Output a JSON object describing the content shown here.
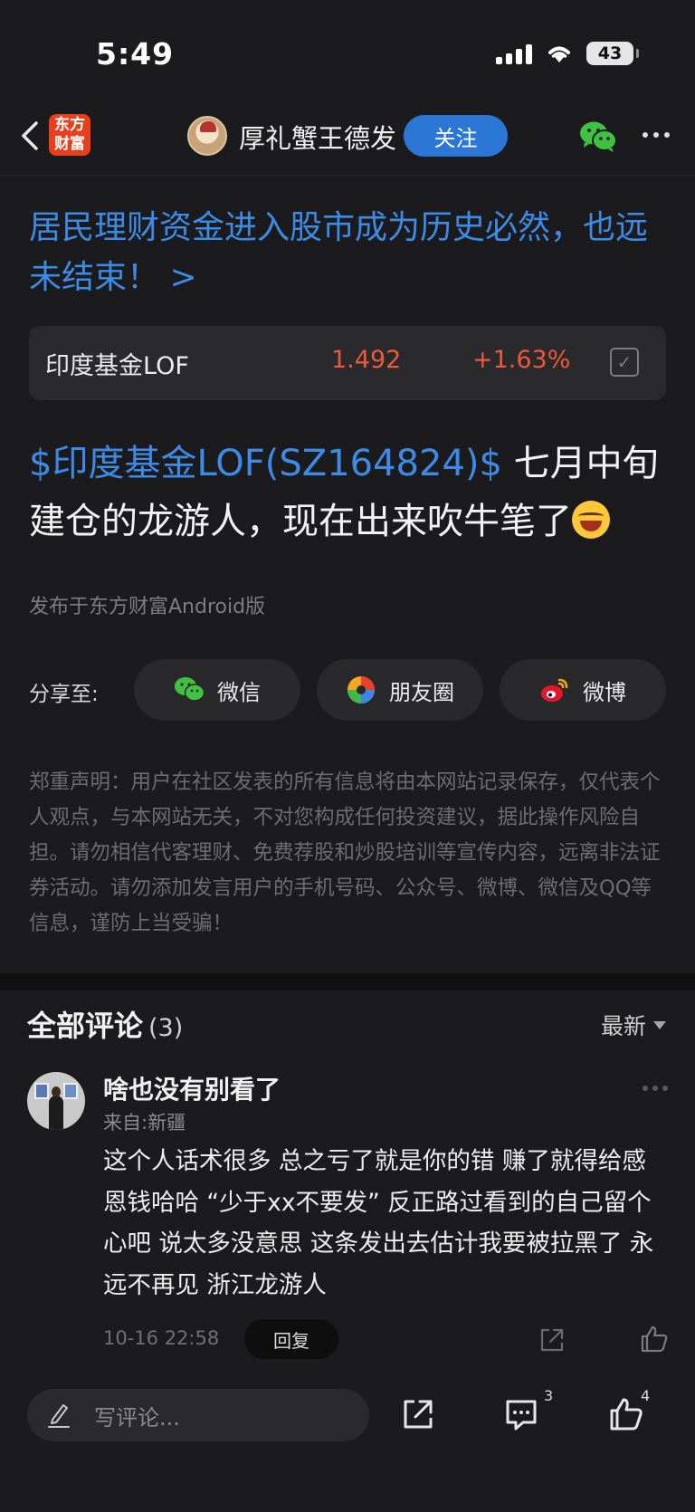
{
  "status_bar": {
    "time": "5:49",
    "battery": "43"
  },
  "nav": {
    "logo_line1": "东方",
    "logo_line2": "财富",
    "user_name": "厚礼蟹王德发",
    "follow_label": "关注"
  },
  "topic_link": "居民理财资金进入股市成为历史必然，也远未结束！ >",
  "fund_card": {
    "name": "印度基金LOF",
    "price": "1.492",
    "change": "+1.63%"
  },
  "post": {
    "stock_tag": "$印度基金LOF(SZ164824)$",
    "body": " 七月中旬建仓的龙游人，现在出来吹牛笔了",
    "source": "发布于东方财富Android版"
  },
  "share": {
    "label": "分享至:",
    "wechat": "微信",
    "moments": "朋友圈",
    "weibo": "微博"
  },
  "disclaimer": "郑重声明：用户在社区发表的所有信息将由本网站记录保存，仅代表个人观点，与本网站无关，不对您构成任何投资建议，据此操作风险自担。请勿相信代客理财、免费荐股和炒股培训等宣传内容，远离非法证券活动。请勿添加发言用户的手机号码、公众号、微博、微信及QQ等信息，谨防上当受骗！",
  "comments": {
    "title": "全部评论",
    "count": "(3)",
    "sort_label": "最新",
    "items": [
      {
        "author": "啥也没有别看了",
        "location": "来自:新疆",
        "text": "这个人话术很多 总之亏了就是你的错 赚了就得给感恩钱哈哈 “少于xx不要发” 反正路过看到的自己留个心吧 说太多没意思 这条发出去估计我要被拉黑了 永远不再见 浙江龙游人",
        "time": "10-16 22:58",
        "reply_label": "回复"
      }
    ]
  },
  "bottom_bar": {
    "input_placeholder": "写评论...",
    "comment_badge": "3",
    "like_badge": "4"
  },
  "colors": {
    "accent_blue": "#3c8be6",
    "price_red": "#ea5a3b",
    "background": "#1b1b1d"
  }
}
